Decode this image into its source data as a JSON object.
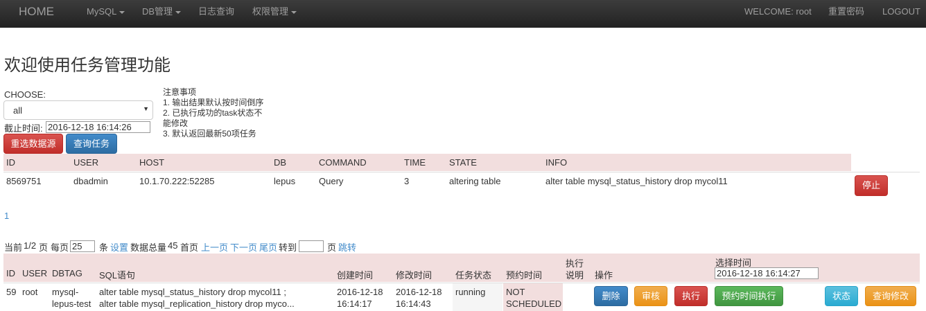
{
  "nav": {
    "brand": "HOME",
    "mysql": "MySQL",
    "dbmanage": "DB管理",
    "logquery": "日志查询",
    "permission": "权限管理",
    "welcome": "WELCOME: root",
    "reset_password": "重置密码",
    "logout": "LOGOUT"
  },
  "page_title": "欢迎使用任务管理功能",
  "form": {
    "choose_label": "CHOOSE:",
    "choose_value": "all",
    "deadline_label": "截止时间:",
    "deadline_value": "2016-12-18 16:14:26",
    "reselect_button": "重选数据源",
    "query_button": "查询任务"
  },
  "notes": {
    "title": "注意事项",
    "line1": "1. 输出结果默认按时间倒序",
    "line2a": "2. 已执行成功的task状态不",
    "line2b": "能修改",
    "line3": "3. 默认返回最新50项任务"
  },
  "process_table": {
    "headers": [
      "ID",
      "USER",
      "HOST",
      "DB",
      "COMMAND",
      "TIME",
      "STATE",
      "INFO"
    ],
    "row": [
      "8569751",
      "dbadmin",
      "10.1.70.222:52285",
      "lepus",
      "Query",
      "3",
      "altering table",
      "alter table mysql_status_history drop mycol11"
    ],
    "stop_button": "停止"
  },
  "process_page": "1",
  "pagination": {
    "current_label": "当前",
    "current_value": "1/2",
    "page_unit": "页",
    "per_page_label": "每页",
    "per_page_value": "25",
    "item_unit": "条",
    "set_link": "设置",
    "total_label": "数据总量",
    "total_value": "45",
    "first_page": "首页",
    "prev_page": "上一页",
    "next_page": "下一页",
    "last_page": "尾页",
    "goto_label": "转到",
    "goto_unit": "页",
    "jump_link": "跳转"
  },
  "task_table": {
    "headers": {
      "id": "ID",
      "user": "USER",
      "dbtag": "DBTAG",
      "sql": "SQL语句",
      "created": "创建时间",
      "modified": "修改时间",
      "status": "任务状态",
      "scheduled": "预约时间",
      "exec_note_a": "执行",
      "exec_note_b": "说明",
      "actions": "操作",
      "choose_time": "选择时间",
      "choose_time_value": "2016-12-18 16:14:27"
    },
    "row": {
      "id": "59",
      "user": "root",
      "dbtag_a": "mysql-",
      "dbtag_b": "lepus-test",
      "sql_a": "alter table mysql_status_history drop mycol11 ;",
      "sql_b": "alter table mysql_replication_history drop myco...",
      "created_a": "2016-12-18",
      "created_b": "16:14:17",
      "modified_a": "2016-12-18",
      "modified_b": "16:14:43",
      "status": "running",
      "scheduled_a": "NOT",
      "scheduled_b": "SCHEDULED"
    },
    "buttons": {
      "delete": "删除",
      "review": "审核",
      "execute": "执行",
      "schedule_exec": "预约时间执行",
      "state": "状态",
      "query_modify": "查询修改"
    }
  }
}
